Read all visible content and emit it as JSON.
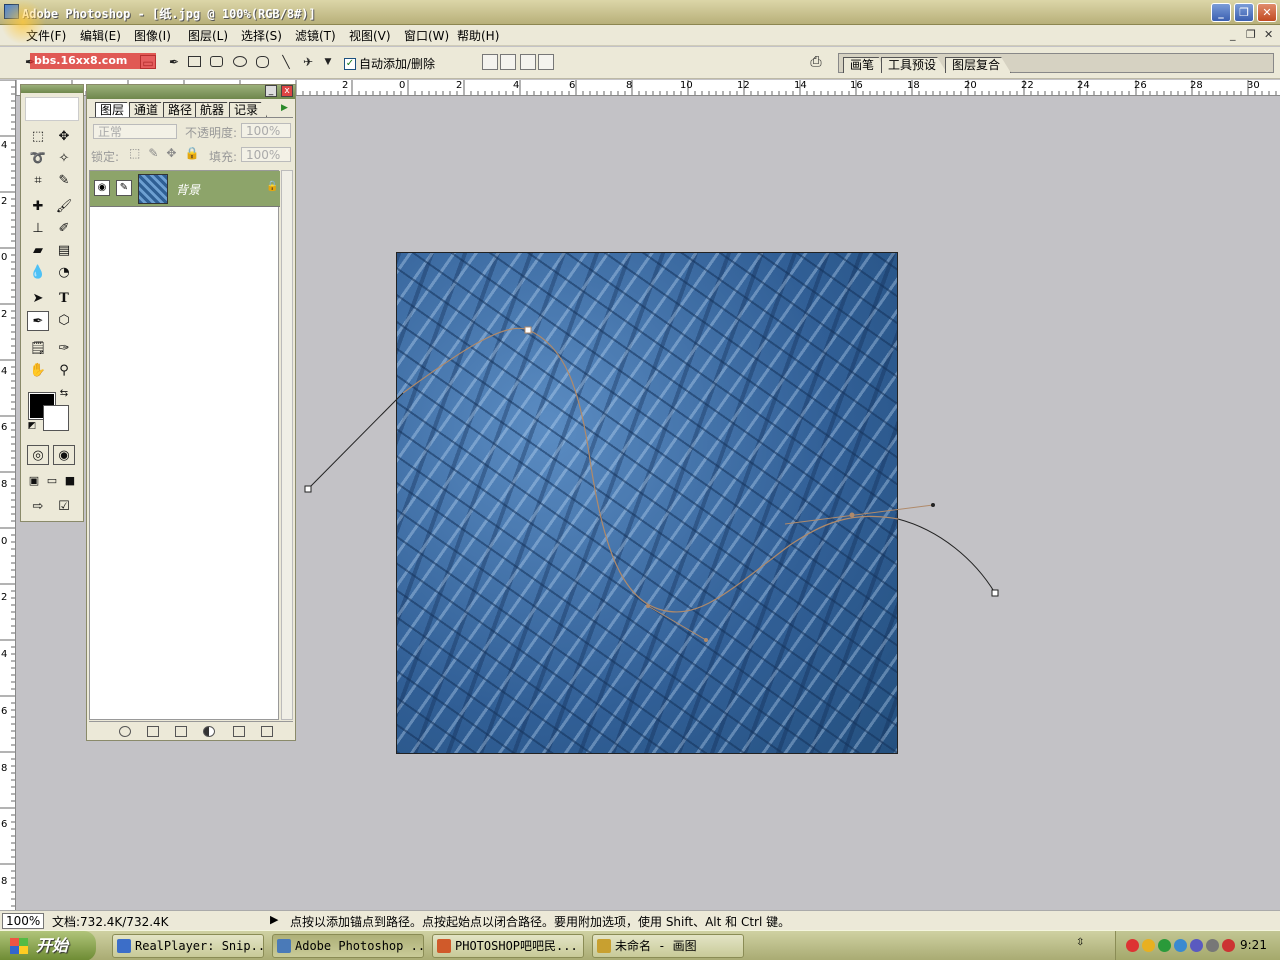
{
  "window": {
    "title": "Adobe Photoshop - [纸.jpg @ 100%(RGB/8#)]",
    "min_label": "_",
    "max_label": "❐",
    "close_label": "✕"
  },
  "menu": {
    "items": [
      "文件(F)",
      "编辑(E)",
      "图像(I)",
      "图层(L)",
      "选择(S)",
      "滤镜(T)",
      "视图(V)",
      "窗口(W)",
      "帮助(H)"
    ],
    "doc_min": "_",
    "doc_restore": "❐",
    "doc_close": "✕"
  },
  "options": {
    "auto_add_label": "自动添加/删除",
    "auto_add_checked": "✓",
    "well_tabs": [
      "画笔",
      "工具预设",
      "图层复合"
    ]
  },
  "rulers": {
    "top": [
      "2",
      "0",
      "2",
      "4",
      "6",
      "8",
      "10",
      "12",
      "14",
      "16",
      "18",
      "20",
      "22",
      "24",
      "26",
      "28",
      "30"
    ],
    "left": [
      "4",
      "2",
      "0",
      "2",
      "4",
      "6",
      "8",
      "0",
      "2",
      "4",
      "6",
      "8",
      "6",
      "8"
    ]
  },
  "layers_panel": {
    "tabs": [
      "图层",
      "通道",
      "路径",
      "航器",
      "记录"
    ],
    "blend_mode": "正常",
    "opacity_label": "不透明度:",
    "opacity_value": "100%",
    "lock_label": "锁定:",
    "fill_label": "填充:",
    "fill_value": "100%",
    "layer_name": "背景"
  },
  "status": {
    "zoom": "100%",
    "doc_info": "文档:732.4K/732.4K",
    "hint": "点按以添加锚点到路径。点按起始点以闭合路径。要用附加选项，使用 Shift、Alt 和 Ctrl 键。"
  },
  "taskbar": {
    "start_label": "开始",
    "tasks": [
      "RealPlayer: Snip...",
      "Adobe Photoshop ...",
      "PHOTOSHOP吧吧民...",
      "未命名 - 画图"
    ],
    "clock": "9:21"
  },
  "watermark": {
    "text": "bbs.16xx8.com"
  },
  "colors": {
    "accent": "#8da46a",
    "canvas_blue": "#3a6ba4",
    "workspace": "#c3c2c6"
  }
}
